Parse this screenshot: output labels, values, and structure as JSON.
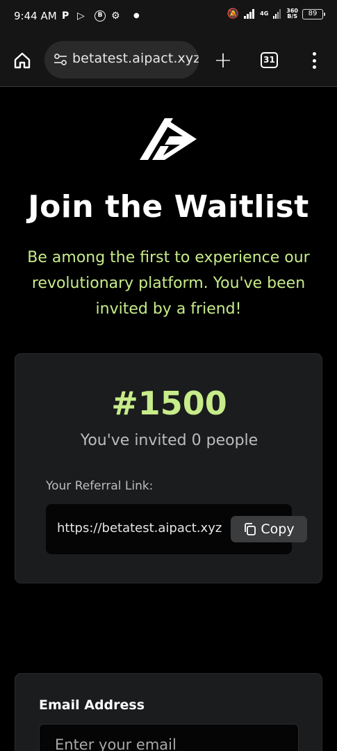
{
  "status_bar": {
    "time": "9:44 AM",
    "icons": [
      "P",
      "b",
      "B",
      "gear",
      "dot"
    ],
    "net_speed_top": "360",
    "net_speed_bottom": "B/S",
    "network": "4G",
    "battery": "89"
  },
  "browser": {
    "url": "betatest.aipact.xyz",
    "tab_count": "31"
  },
  "page": {
    "title": "Join the Waitlist",
    "subtitle": "Be among the first to experience our revolutionary platform. You've been invited by a friend!",
    "rank": "#1500",
    "invited_text": "You've invited 0 people",
    "referral_label": "Your Referral Link:",
    "referral_link": "https://betatest.aipact.xyz",
    "copy_label": "Copy",
    "email_label": "Email Address",
    "email_placeholder": "Enter your email"
  },
  "colors": {
    "accent": "#c7ec8a",
    "background": "#000000",
    "card": "#1b1c1d"
  }
}
